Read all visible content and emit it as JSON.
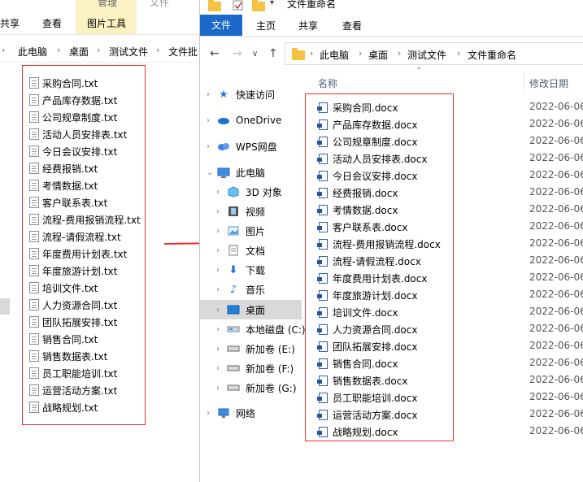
{
  "back_window": {
    "ribbon_tabs": [
      "共享",
      "查看"
    ],
    "manage_label": "管理",
    "picture_tools_label": "图片工具",
    "file_label": "文件",
    "breadcrumb": [
      "此电脑",
      "桌面",
      "测试文件",
      "文件批"
    ],
    "files": [
      "采购合同.txt",
      "产品库存数据.txt",
      "公司规章制度.txt",
      "活动人员安排表.txt",
      "今日会议安排.txt",
      "经费报销.txt",
      "考情数据.txt",
      "客户联系表.txt",
      "流程-费用报销流程.txt",
      "流程-请假流程.txt",
      "年度费用计划表.txt",
      "年度旅游计划.txt",
      "培训文件.txt",
      "人力资源合同.txt",
      "团队拓展安排.txt",
      "销售合同.txt",
      "销售数据表.txt",
      "员工职能培训.txt",
      "运营活动方案.txt",
      "战略规划.txt"
    ]
  },
  "front_window": {
    "title": "文件重命名",
    "ribbon": {
      "file": "文件",
      "home": "主页",
      "share": "共享",
      "view": "查看"
    },
    "breadcrumb": [
      "此电脑",
      "桌面",
      "测试文件",
      "文件重命名"
    ],
    "nav": [
      {
        "label": "快速访问",
        "icon": "star-icon"
      },
      {
        "label": "OneDrive",
        "icon": "cloud-icon"
      },
      {
        "label": "WPS网盘",
        "icon": "wps-cloud-icon"
      },
      {
        "label": "此电脑",
        "icon": "computer-icon"
      },
      {
        "label": "3D 对象",
        "icon": "cube-icon"
      },
      {
        "label": "视频",
        "icon": "film-icon"
      },
      {
        "label": "图片",
        "icon": "picture-icon"
      },
      {
        "label": "文档",
        "icon": "document-icon"
      },
      {
        "label": "下载",
        "icon": "download-icon"
      },
      {
        "label": "音乐",
        "icon": "music-icon"
      },
      {
        "label": "桌面",
        "icon": "desktop-icon"
      },
      {
        "label": "本地磁盘 (C:)",
        "icon": "drive-icon"
      },
      {
        "label": "新加卷 (E:)",
        "icon": "drive-icon"
      },
      {
        "label": "新加卷 (F:)",
        "icon": "drive-icon"
      },
      {
        "label": "新加卷 (G:)",
        "icon": "drive-icon"
      },
      {
        "label": "网络",
        "icon": "network-icon"
      }
    ],
    "columns": {
      "name": "名称",
      "modified": "修改日期"
    },
    "files": [
      {
        "name": "采购合同.docx",
        "date": "2022-06-06"
      },
      {
        "name": "产品库存数据.docx",
        "date": "2022-06-06"
      },
      {
        "name": "公司规章制度.docx",
        "date": "2022-06-06"
      },
      {
        "name": "活动人员安排表.docx",
        "date": "2022-06-06"
      },
      {
        "name": "今日会议安排.docx",
        "date": "2022-06-06"
      },
      {
        "name": "经费报销.docx",
        "date": "2022-06-06"
      },
      {
        "name": "考情数据.docx",
        "date": "2022-06-06"
      },
      {
        "name": "客户联系表.docx",
        "date": "2022-06-06"
      },
      {
        "name": "流程-费用报销流程.docx",
        "date": "2022-06-06"
      },
      {
        "name": "流程-请假流程.docx",
        "date": "2022-06-06"
      },
      {
        "name": "年度费用计划表.docx",
        "date": "2022-06-06"
      },
      {
        "name": "年度旅游计划.docx",
        "date": "2022-06-06"
      },
      {
        "name": "培训文件.docx",
        "date": "2022-06-06"
      },
      {
        "name": "人力资源合同.docx",
        "date": "2022-06-06"
      },
      {
        "name": "团队拓展安排.docx",
        "date": "2022-06-06"
      },
      {
        "name": "销售合同.docx",
        "date": "2022-06-06"
      },
      {
        "name": "销售数据表.docx",
        "date": "2022-06-06"
      },
      {
        "name": "员工职能培训.docx",
        "date": "2022-06-06"
      },
      {
        "name": "运营活动方案.docx",
        "date": "2022-06-06"
      },
      {
        "name": "战略规划.docx",
        "date": "2022-06-06"
      }
    ]
  },
  "colors": {
    "accent": "#1b6ac9",
    "highlight_box": "#e8312f",
    "manage_tab": "#fbf2c4"
  }
}
